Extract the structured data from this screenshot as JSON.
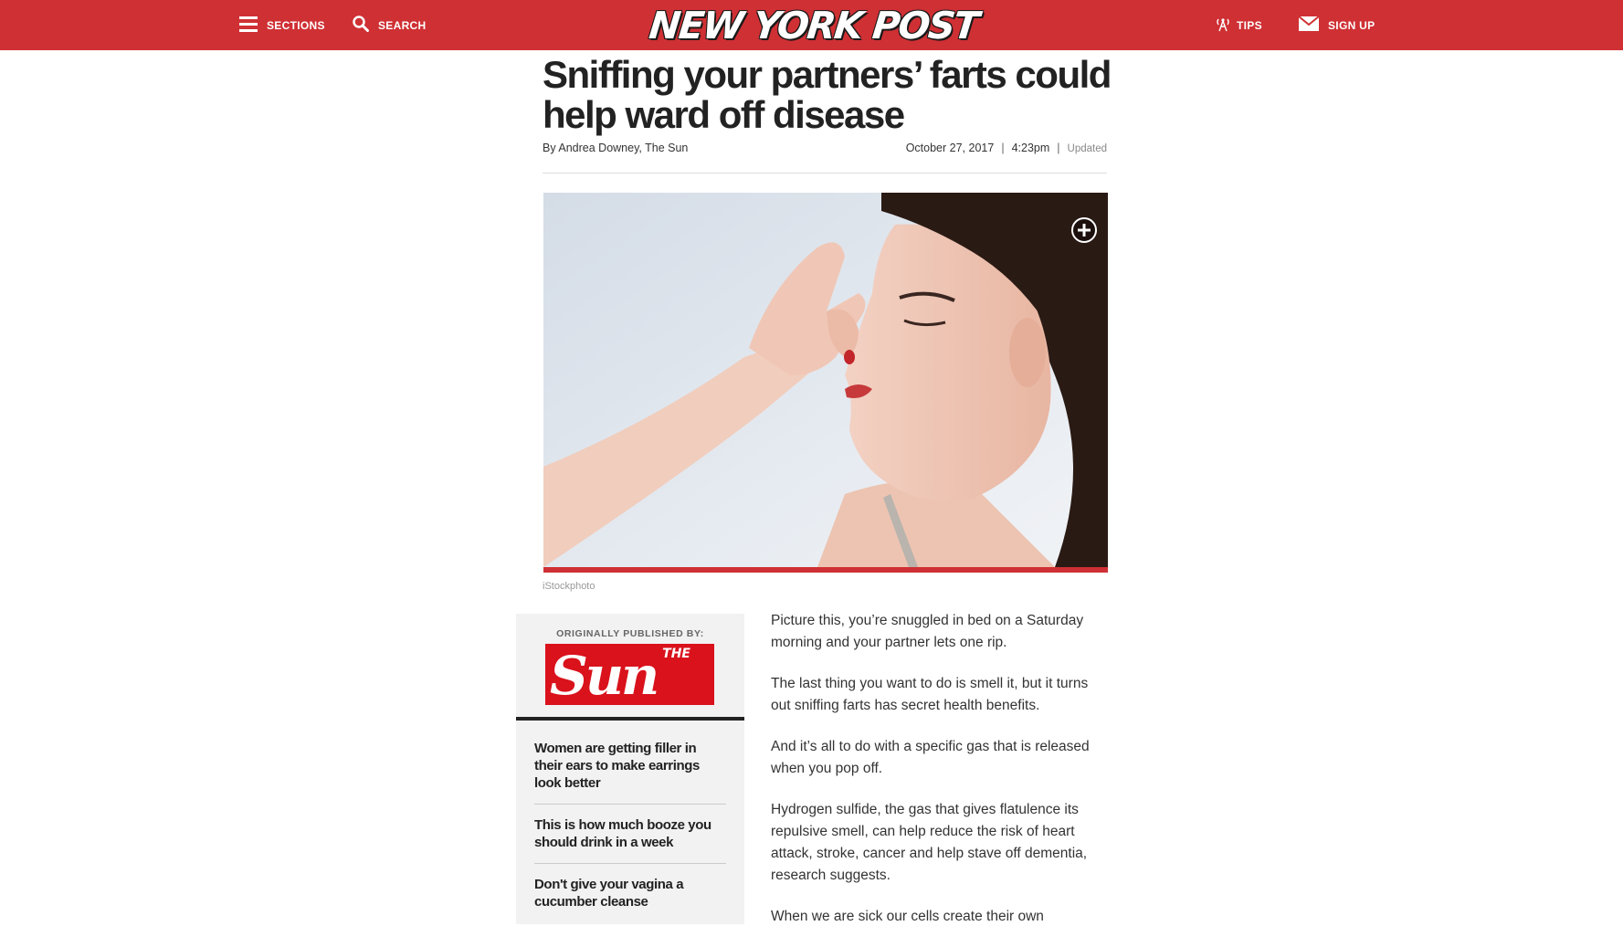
{
  "header": {
    "sections_label": "SECTIONS",
    "search_label": "SEARCH",
    "logo_text": "NEW YORK POST",
    "tips_label": "TIPS",
    "signup_label": "SIGN UP"
  },
  "article": {
    "headline": "Sniffing your partners’ farts could help ward off disease",
    "byline_prefix": "By",
    "byline_author": "Andrea Downey, The Sun",
    "date": "October 27, 2017",
    "time": "4:23pm",
    "separator": "|",
    "updated_label": "Updated",
    "photo_credit": "iStockphoto",
    "paragraphs": [
      "Picture this, you’re snuggled in bed on a Saturday morning and your partner lets one rip.",
      "The last thing you want to do is smell it, but it turns out sniffing farts has secret health benefits.",
      "And it’s all to do with a specific gas that is released when you pop off.",
      "Hydrogen sulfide, the gas that gives flatulence its repulsive smell, can help reduce the risk of heart attack, stroke, cancer and help stave off dementia, research suggests.",
      "When we are sick our cells create their own"
    ]
  },
  "sidebar": {
    "originally_published_label": "ORIGINALLY PUBLISHED BY:",
    "publisher_logo_small": "THE",
    "publisher_logo_big": "Sun",
    "links": [
      "Women are getting filler in their ears to make earrings look better",
      "This is how much booze you should drink in a week",
      "Don't give your vagina a cucumber cleanse"
    ]
  },
  "colors": {
    "brand_red": "#cf3034",
    "sun_red": "#d9121c"
  }
}
